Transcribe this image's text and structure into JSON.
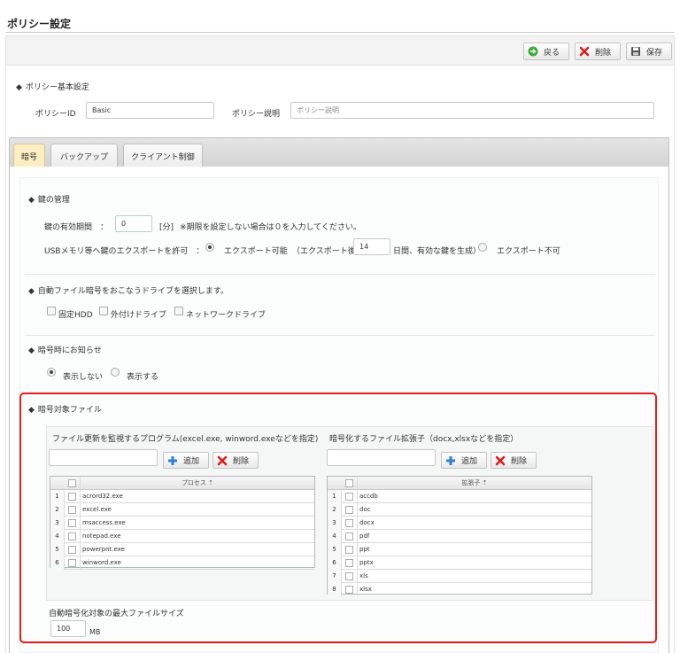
{
  "page": {
    "title": "ポリシー設定"
  },
  "toolbar": {
    "back_label": "戻る",
    "delete_label": "削除",
    "save_label": "保存"
  },
  "basic": {
    "section_title": "ポリシー基本設定",
    "id_label": "ポリシーID",
    "id_value": "Basic",
    "desc_label": "ポリシー説明",
    "desc_placeholder": "ポリシー説明"
  },
  "tabs": [
    {
      "label": "暗号",
      "active": true
    },
    {
      "label": "バックアップ",
      "active": false
    },
    {
      "label": "クライアント制御",
      "active": false
    }
  ],
  "key_mgmt": {
    "section_title": "鍵の管理",
    "validity_label": "鍵の有効期間　：",
    "validity_value": "0",
    "validity_unit": "[分]",
    "validity_note": "※期限を設定しない場合は０を入力してください。",
    "usb_label": "USBメモリ等へ鍵のエクスポートを許可　：",
    "export_allowed_label": "エクスポート可能",
    "export_after_label": "（エクスポート後",
    "export_days_value": "14",
    "export_days_suffix": "日間、有効な鍵を生成）",
    "export_denied_label": "エクスポート不可"
  },
  "drives": {
    "section_title": "自動ファイル暗号をおこなうドライブを選択します。",
    "options": [
      "固定HDD",
      "外付けドライブ",
      "ネットワークドライブ"
    ]
  },
  "notice": {
    "section_title": "暗号時にお知らせ",
    "options": [
      "表示しない",
      "表示する"
    ],
    "selected": "表示しない"
  },
  "target_files": {
    "section_title": "暗号対象ファイル",
    "programs": {
      "title": "ファイル更新を監視するプログラム(excel.exe, winword.exeなどを指定)",
      "add_label": "追加",
      "delete_label": "削除",
      "column_header": "プロセス",
      "rows": [
        "acrord32.exe",
        "excel.exe",
        "msaccess.exe",
        "notepad.exe",
        "powerpnt.exe",
        "winword.exe"
      ]
    },
    "extensions": {
      "title": "暗号化するファイル拡張子（docx,xlsxなどを指定）",
      "add_label": "追加",
      "delete_label": "削除",
      "column_header": "拡張子",
      "rows": [
        "accdb",
        "doc",
        "docx",
        "pdf",
        "ppt",
        "pptx",
        "xls",
        "xlsx"
      ]
    },
    "max_size_label": "自動暗号化対象の最大ファイルサイズ",
    "max_size_value": "100",
    "max_size_unit": "MB"
  },
  "colors": {
    "highlight": "#e11d1d",
    "active_tab": "#fbeec2",
    "add_icon": "#2f7fd6",
    "delete_icon": "#d62020",
    "back_icon": "#3aaa3a"
  }
}
